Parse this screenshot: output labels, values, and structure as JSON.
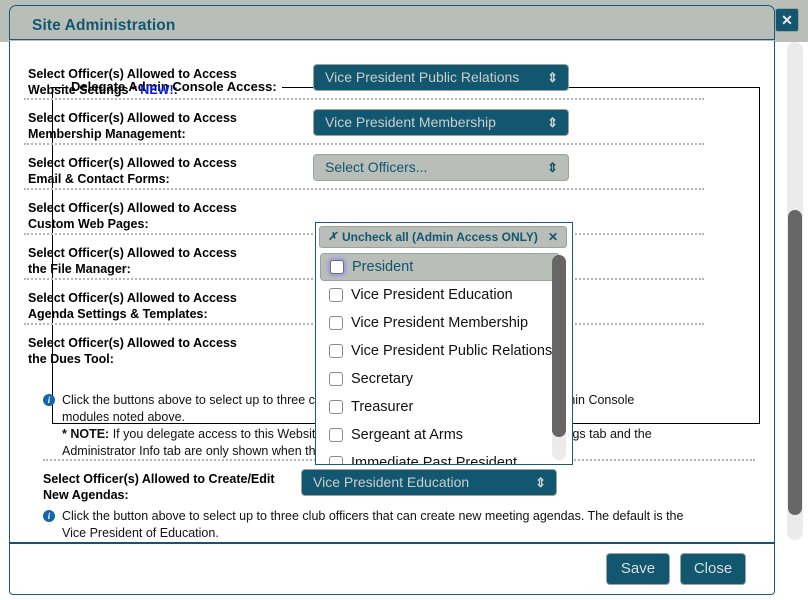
{
  "window": {
    "title": "Site Administration",
    "close_icon": "✕"
  },
  "fieldset": {
    "legend": "Delegate Admin Console Access:"
  },
  "rows": [
    {
      "label_line1": "Select Officer(s) Allowed to Access",
      "label_line2": "Website Settings * ",
      "label_new": "NEW!",
      "label_tail": ":",
      "value": "Vice President Public Relations",
      "state": "filled"
    },
    {
      "label_line1": "Select Officer(s) Allowed to Access",
      "label_line2": "Membership Management:",
      "value": "Vice President Membership",
      "state": "filled"
    },
    {
      "label_line1": "Select Officer(s) Allowed to Access",
      "label_line2": "Email & Contact Forms:",
      "value": "Select Officers...",
      "state": "empty"
    },
    {
      "label_line1": "Select Officer(s) Allowed to Access",
      "label_line2": "Custom Web Pages:",
      "value": "",
      "state": "hidden"
    },
    {
      "label_line1": "Select Officer(s) Allowed to Access",
      "label_line2": "the File Manager:",
      "value": "",
      "state": "hidden"
    },
    {
      "label_line1": "Select Officer(s) Allowed to Access",
      "label_line2": "Agenda Settings & Templates:",
      "value": "",
      "state": "hidden"
    },
    {
      "label_line1": "Select Officer(s) Allowed to Access",
      "label_line2": "the Dues Tool:",
      "value": "",
      "state": "hidden"
    }
  ],
  "dropdown": {
    "uncheck_mark": "✗",
    "uncheck_label": "Uncheck all (Admin Access ONLY)",
    "close_icon": "✕",
    "items": [
      {
        "label": "President",
        "checked": false,
        "selected": true
      },
      {
        "label": "Vice President Education",
        "checked": false,
        "selected": false
      },
      {
        "label": "Vice President Membership",
        "checked": false,
        "selected": false
      },
      {
        "label": "Vice President Public Relations",
        "checked": false,
        "selected": false
      },
      {
        "label": "Secretary",
        "checked": false,
        "selected": false
      },
      {
        "label": "Treasurer",
        "checked": false,
        "selected": false
      },
      {
        "label": "Sergeant at Arms",
        "checked": false,
        "selected": false
      },
      {
        "label": "Immediate Past President",
        "checked": false,
        "selected": false
      }
    ]
  },
  "note1": {
    "line1": "Click the buttons above to select up to three club officers that can access the respective Admin Console",
    "line2": "modules noted above.",
    "note_label": "* NOTE:",
    "line3": " If you delegate access to this Website Settings module, note that this Access Settings tab and the",
    "line4": "Administrator Info tab are only shown when the admin is logged in."
  },
  "agenda_row": {
    "label_line1": "Select Officer(s) Allowed to Create/Edit",
    "label_line2": "New Agendas:",
    "value": "Vice President Education"
  },
  "note2": {
    "line1": "Click the button above to select up to three club officers that can create new meeting agendas. The default is the",
    "line2": "Vice President of Education."
  },
  "footer": {
    "save_label": "Save",
    "close_label": "Close"
  },
  "icons": {
    "updown_arrows": "⇕",
    "info": "i"
  }
}
